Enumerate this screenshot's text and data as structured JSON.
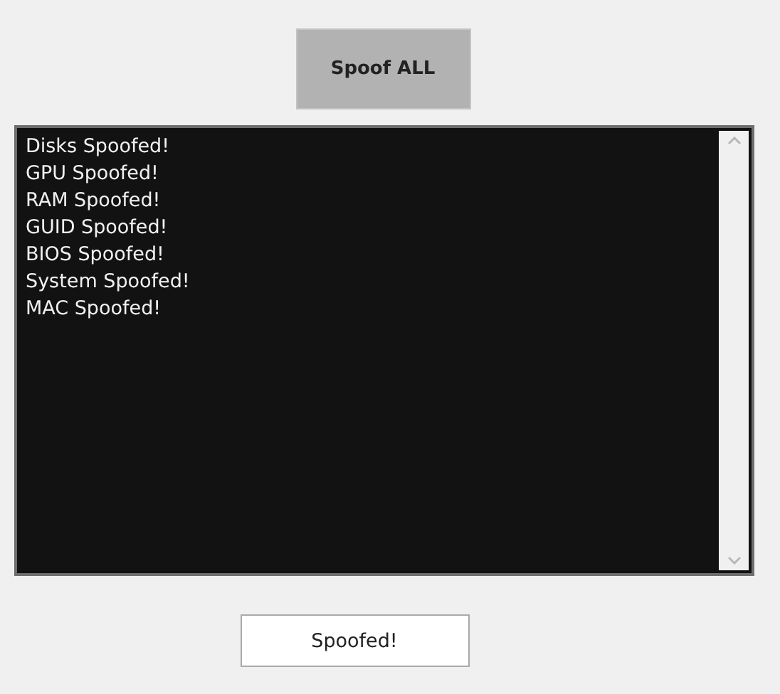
{
  "spoof_button": {
    "label": "Spoof ALL"
  },
  "log_lines": [
    "Disks Spoofed!",
    "GPU Spoofed!",
    "RAM Spoofed!",
    "GUID Spoofed!",
    "BIOS Spoofed!",
    "System Spoofed!",
    "MAC Spoofed!"
  ],
  "status_field": {
    "value": "Spoofed!"
  }
}
